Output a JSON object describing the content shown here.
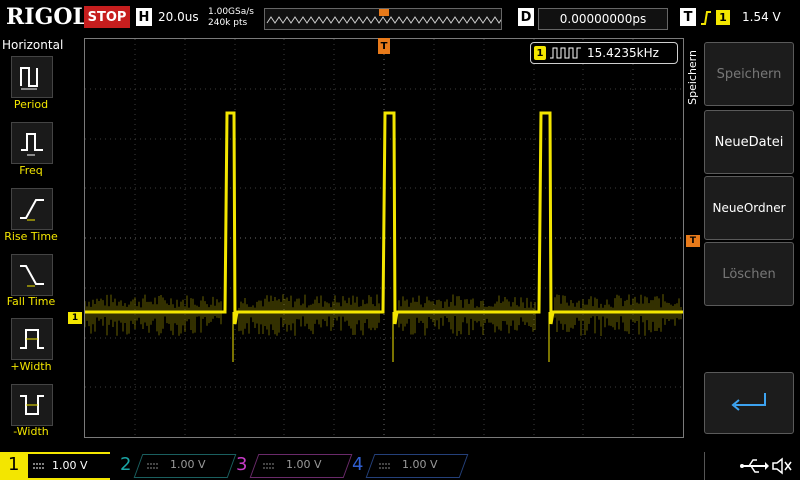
{
  "top": {
    "logo": "RIGOL",
    "status": "STOP",
    "h_tag": "H",
    "timebase": "20.0us",
    "sample_rate": "1.00GSa/s",
    "points": "240k pts",
    "d_tag": "D",
    "delay": "0.00000000ps",
    "t_tag": "T",
    "trigger_channel": "1",
    "trigger_level": "1.54 V"
  },
  "left": {
    "title": "Horizontal",
    "items": [
      {
        "label": "Period",
        "icon": "period-icon"
      },
      {
        "label": "Freq",
        "icon": "freq-icon"
      },
      {
        "label": "Rise Time",
        "icon": "rise-time-icon"
      },
      {
        "label": "Fall Time",
        "icon": "fall-time-icon"
      },
      {
        "label": "+Width",
        "icon": "pos-width-icon"
      },
      {
        "label": "-Width",
        "icon": "neg-width-icon"
      }
    ]
  },
  "screen": {
    "trigger_marker": "T",
    "channel_marker": "1",
    "measurement_channel": "1",
    "measurement_value": "15.4235kHz"
  },
  "right": {
    "title": "Speichern",
    "buttons": [
      {
        "label": "Speichern",
        "enabled": false
      },
      {
        "label": "NeueDatei",
        "enabled": true
      },
      {
        "label": "NeueOrdner",
        "enabled": true
      },
      {
        "label": "Löschen",
        "enabled": false
      }
    ],
    "return_icon": "return-arrow-icon"
  },
  "bottom": {
    "channels": [
      {
        "num": "1",
        "value": "1.00 V",
        "color": "#f3e600",
        "active": true
      },
      {
        "num": "2",
        "value": "1.00 V",
        "color": "#1aa6a6",
        "active": false
      },
      {
        "num": "3",
        "value": "1.00 V",
        "color": "#c83cc8",
        "active": false
      },
      {
        "num": "4",
        "value": "1.00 V",
        "color": "#2f5fd0",
        "active": false
      }
    ],
    "usb_icon": "usb-icon",
    "speaker_icon": "speaker-mute-icon"
  },
  "colors": {
    "trace": "#f3e600",
    "trigger": "#e87a1a",
    "stop": "#c61e1e"
  }
}
